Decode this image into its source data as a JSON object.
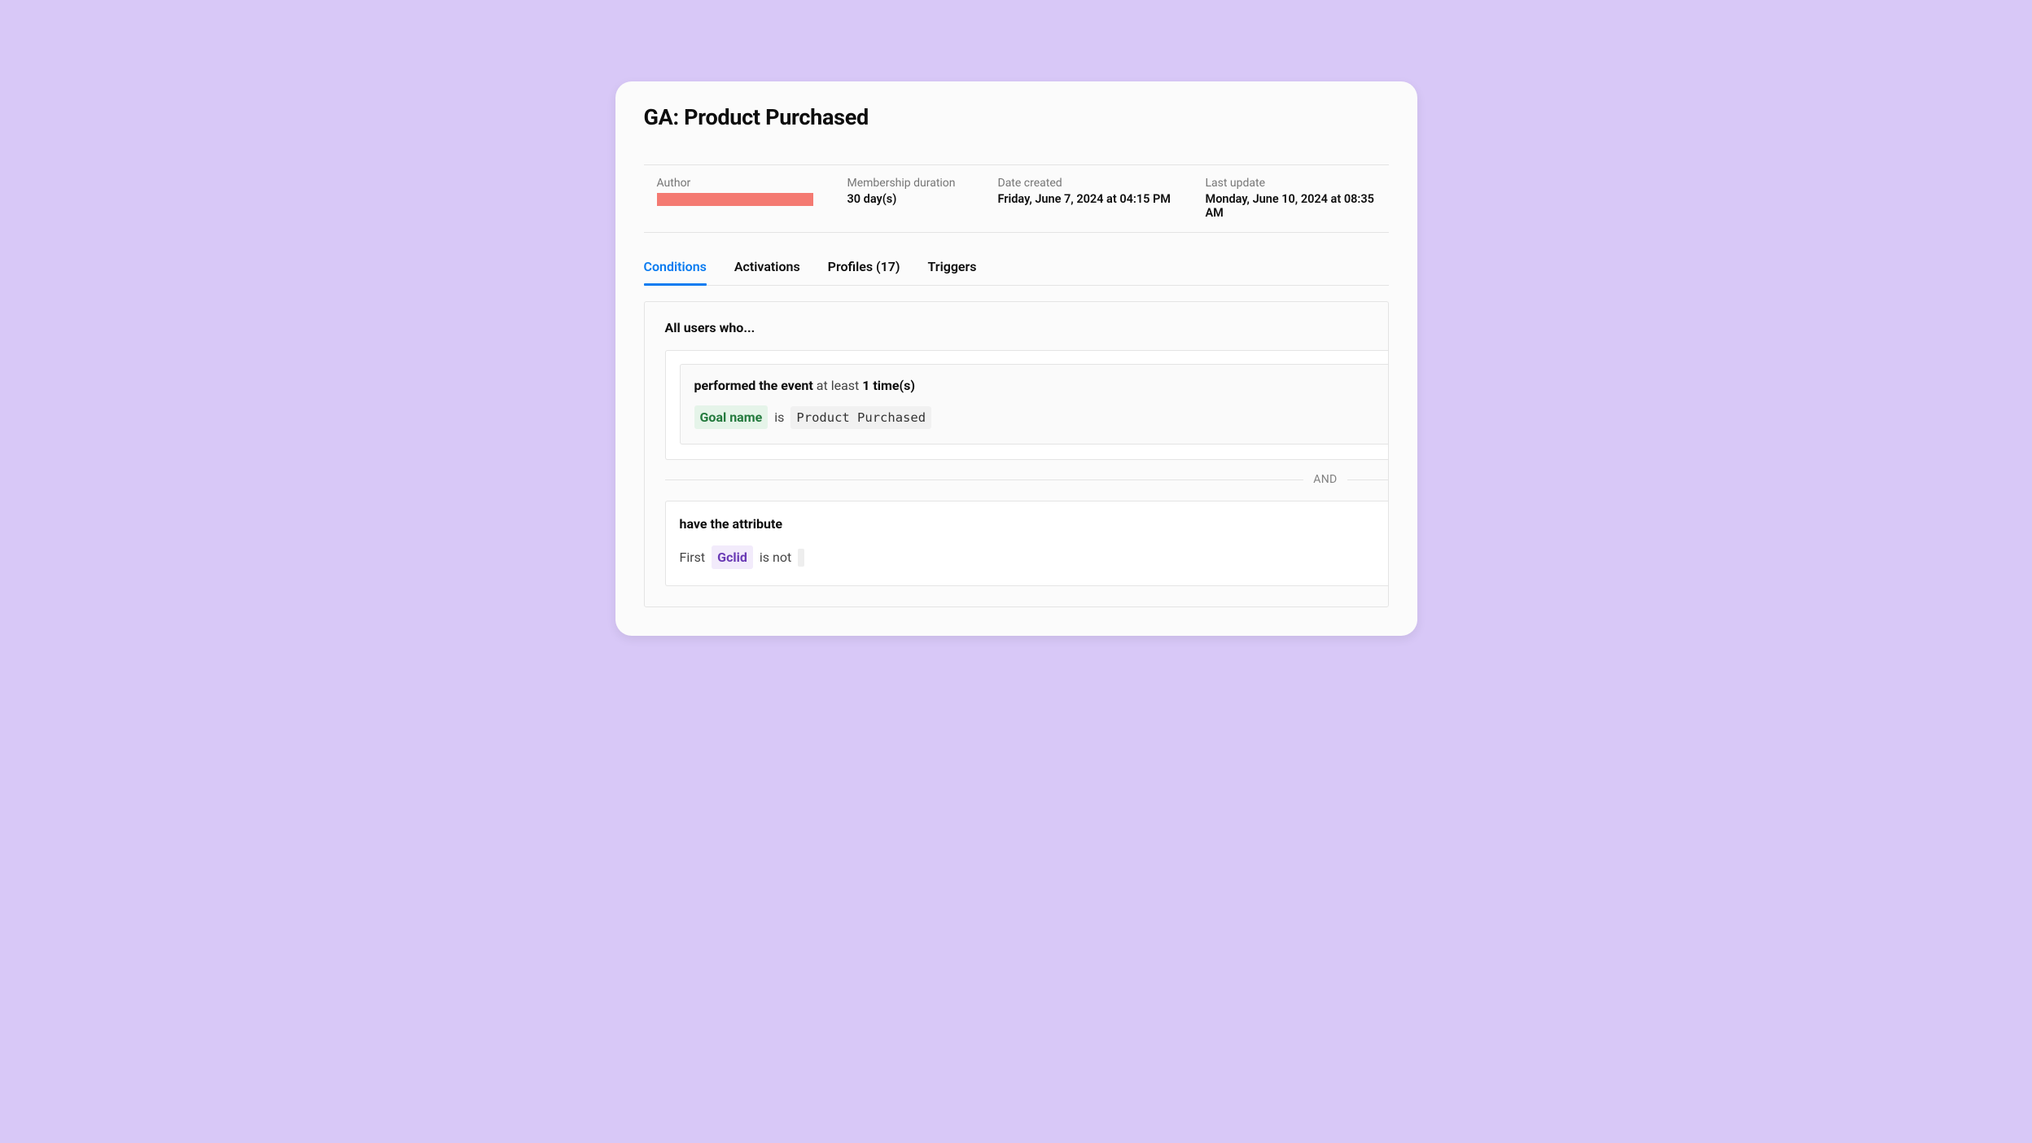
{
  "title": "GA: Product Purchased",
  "meta": {
    "author_label": "Author",
    "membership_label": "Membership duration",
    "membership_value": "30 day(s)",
    "created_label": "Date created",
    "created_value": "Friday, June 7, 2024 at 04:15 PM",
    "updated_label": "Last update",
    "updated_value": "Monday, June 10, 2024 at 08:35 AM"
  },
  "tabs": {
    "conditions": "Conditions",
    "activations": "Activations",
    "profiles": "Profiles (17)",
    "triggers": "Triggers"
  },
  "conditions": {
    "intro": "All users who...",
    "event": {
      "prefix_bold": "performed the event",
      "middle": " at least ",
      "count_bold": "1 time(s)",
      "field_name": "Goal name",
      "operator": "is",
      "value": "Product Purchased"
    },
    "separator": "AND",
    "attribute": {
      "heading": "have the attribute",
      "prefix": "First",
      "field_name": "Gclid",
      "operator": "is not",
      "value": ""
    }
  }
}
